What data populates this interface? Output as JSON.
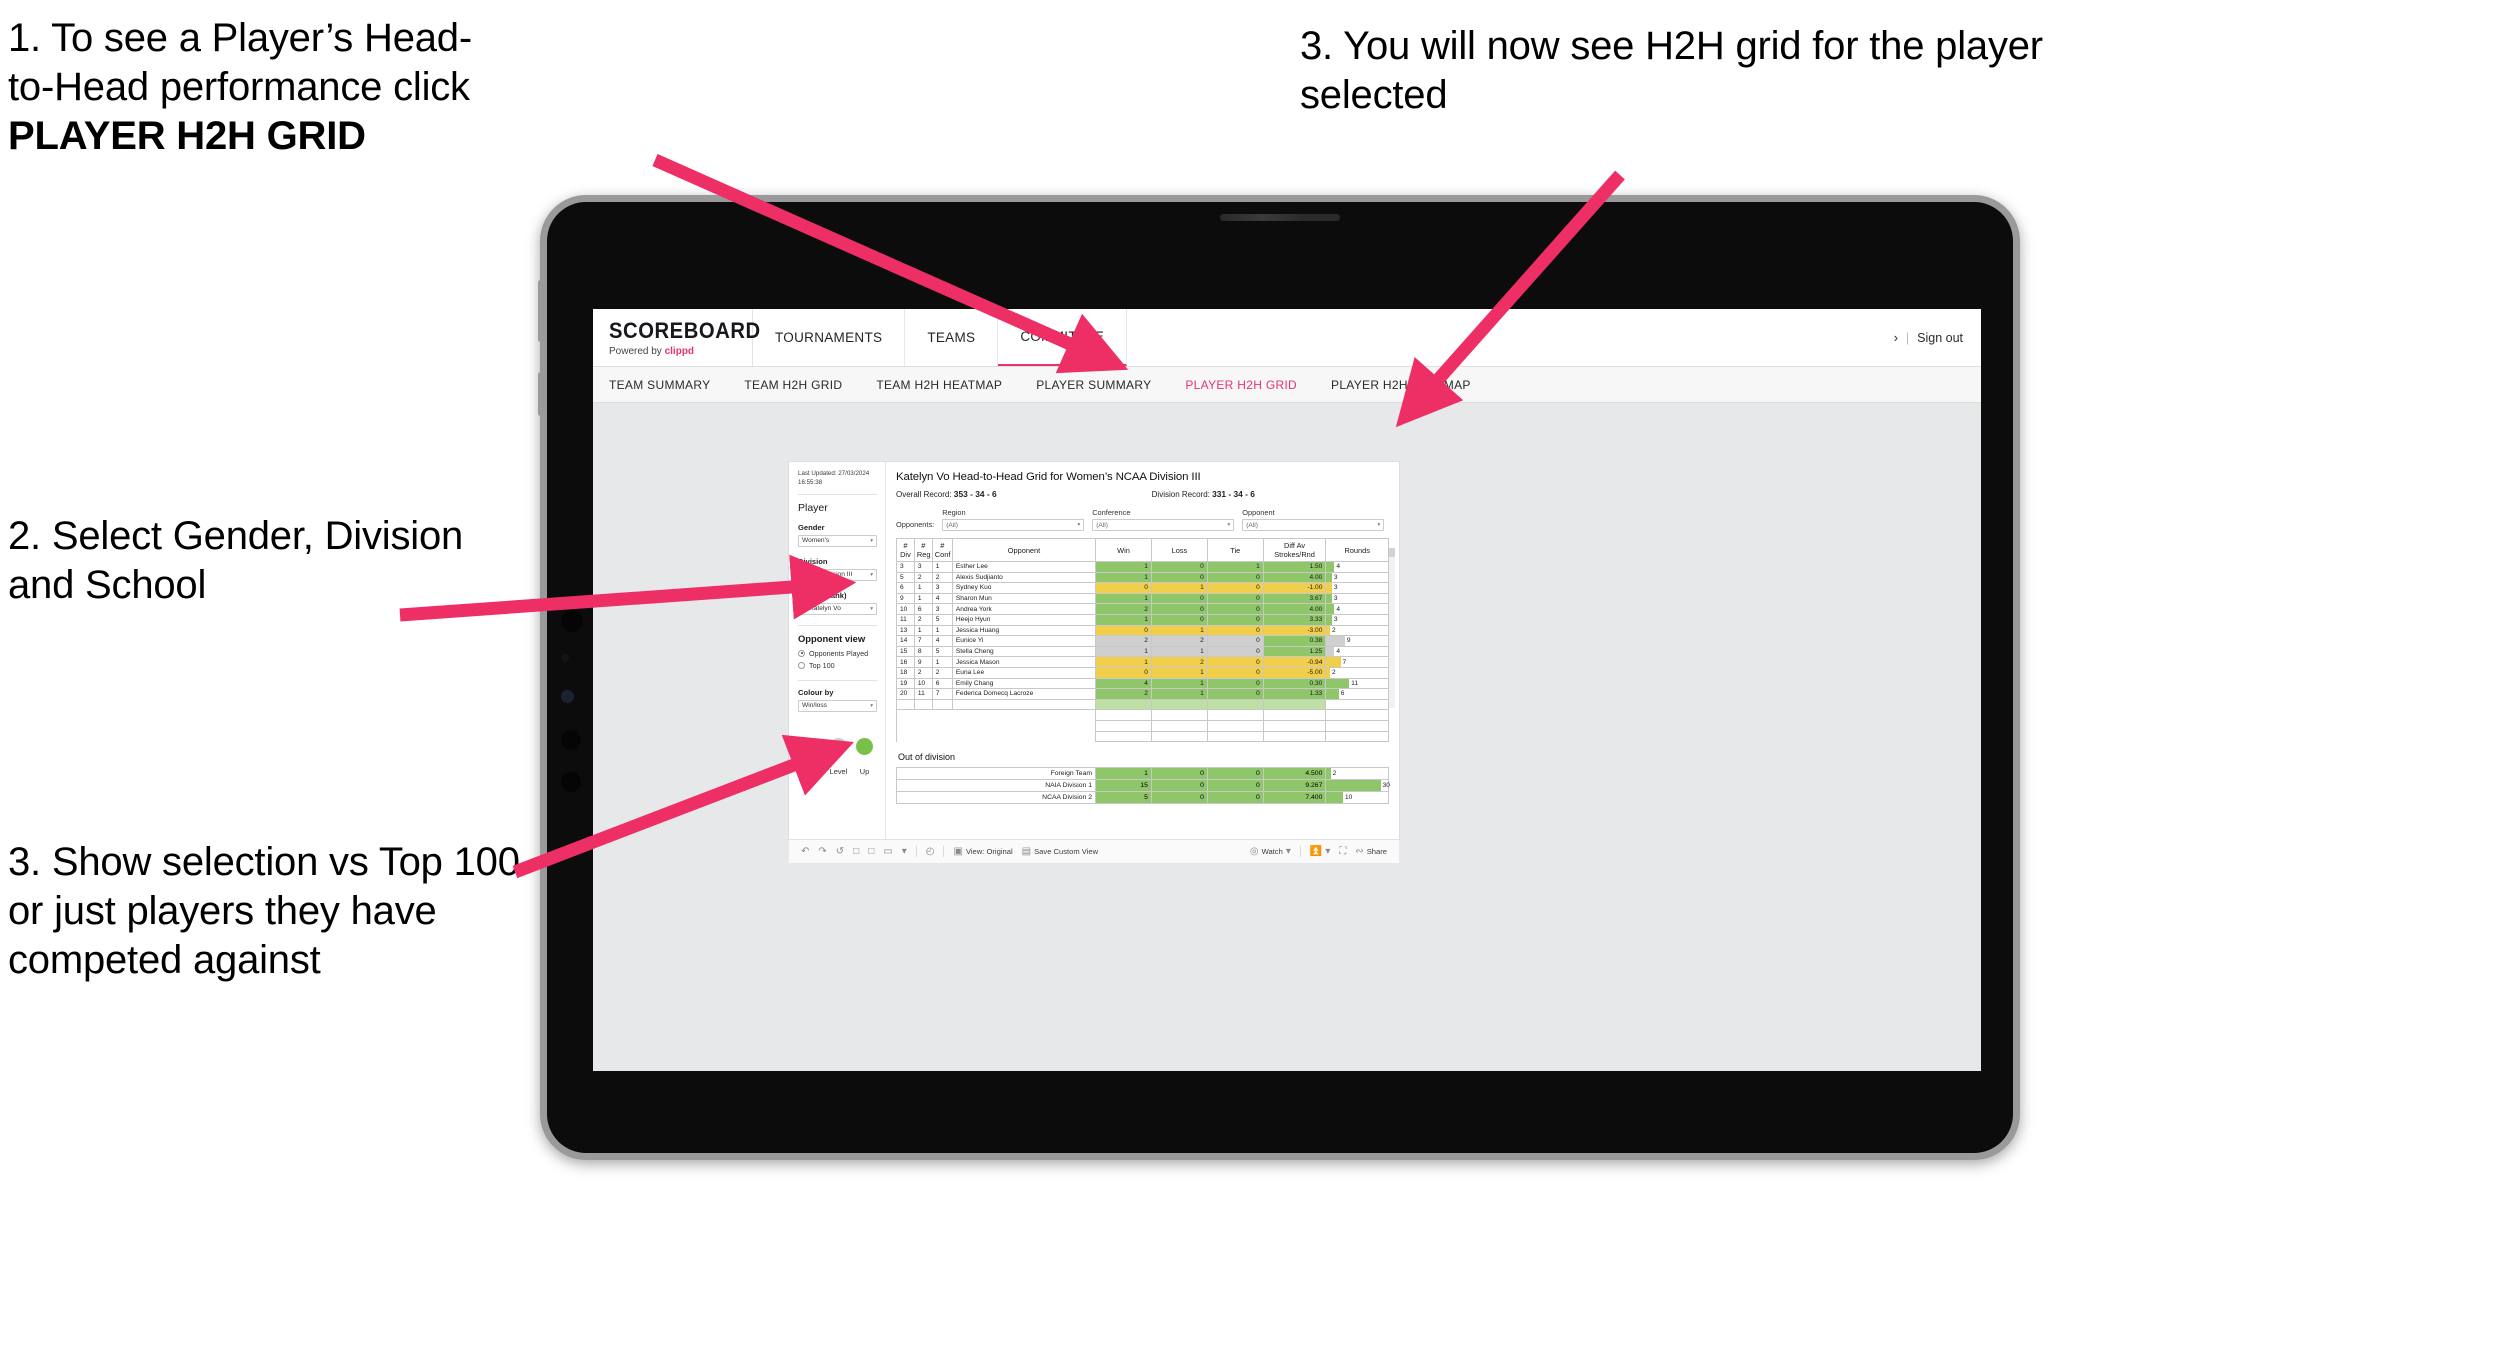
{
  "annotations": {
    "a1_line1": "1. To see a Player’s Head-",
    "a1_line2": "to-Head performance click",
    "a1_bold": "PLAYER H2H GRID",
    "a2": "2. Select Gender, Division and School",
    "a3": "3. Show selection vs Top 100 or just players they have competed against",
    "a4": "3. You will now see H2H grid for the player selected"
  },
  "brand": {
    "title": "SCOREBOARD",
    "powered_prefix": "Powered by ",
    "powered_name": "clippd"
  },
  "topnav": {
    "items": [
      "TOURNAMENTS",
      "TEAMS",
      "COMMITTEE"
    ],
    "active": "COMMITTEE",
    "chevron": "›",
    "separator": "|",
    "signout": "Sign out"
  },
  "subnav": {
    "items": [
      "TEAM SUMMARY",
      "TEAM H2H GRID",
      "TEAM H2H HEATMAP",
      "PLAYER SUMMARY",
      "PLAYER H2H GRID",
      "PLAYER H2H HEATMAP"
    ],
    "active": "PLAYER H2H GRID"
  },
  "panel": {
    "updated_line1": "Last Updated: 27/03/2024",
    "updated_line2": "16:55:38",
    "heading": "Player",
    "gender_label": "Gender",
    "gender_value": "Women's",
    "division_label": "Division",
    "division_value": "NCAA Division III",
    "player_label": "Player (Rank)",
    "player_value": "8. Katelyn Vo",
    "opponent_view_heading": "Opponent view",
    "radio_played": "Opponents Played",
    "radio_top100": "Top 100",
    "colour_by_label": "Colour by",
    "colour_by_value": "Win/loss",
    "legend": [
      {
        "label": "Down",
        "color": "#f2cf4a"
      },
      {
        "label": "Level",
        "color": "#cfcfcf"
      },
      {
        "label": "Up",
        "color": "#8fc66a"
      }
    ],
    "caret": "▾"
  },
  "viz": {
    "title": "Katelyn Vo Head-to-Head Grid for Women’s NCAA Division III",
    "overall_label": "Overall Record: ",
    "overall_value": "353 -  34 - 6",
    "division_label": "Division Record: ",
    "division_value": "331 -  34 - 6",
    "opponents_label": "Opponents:",
    "filters": [
      {
        "label": "Region",
        "value": "(All)"
      },
      {
        "label": "Conference",
        "value": "(All)"
      },
      {
        "label": "Opponent",
        "value": "(All)"
      }
    ],
    "headers": [
      "#\nDiv",
      "#\nReg",
      "#\nConf",
      "Opponent",
      "Win",
      "Loss",
      "Tie",
      "Diff Av\nStrokes/Rnd",
      "Rounds"
    ],
    "header_div_1": "#",
    "header_div_2": "Div",
    "header_reg_1": "#",
    "header_reg_2": "Reg",
    "header_conf_1": "#",
    "header_conf_2": "Conf",
    "header_opponent": "Opponent",
    "header_win": "Win",
    "header_loss": "Loss",
    "header_tie": "Tie",
    "header_diff_1": "Diff Av",
    "header_diff_2": "Strokes/Rnd",
    "header_rounds": "Rounds",
    "out_of_division_title": "Out of division"
  },
  "chart_data": {
    "type": "table",
    "title": "Katelyn Vo Head-to-Head Grid for Women’s NCAA Division III",
    "columns": [
      "# Div",
      "# Reg",
      "# Conf",
      "Opponent",
      "Win",
      "Loss",
      "Tie",
      "Diff Av Strokes/Rnd",
      "Rounds"
    ],
    "rows": [
      {
        "div": "3",
        "reg": "3",
        "conf": "1",
        "opponent": "Esther Lee",
        "win": "1",
        "loss": "0",
        "tie": "1",
        "diff": "1.50",
        "rounds": "4",
        "state": "up",
        "diff_state": "up",
        "rounds_pct": 13
      },
      {
        "div": "5",
        "reg": "2",
        "conf": "2",
        "opponent": "Alexis Sudjianto",
        "win": "1",
        "loss": "0",
        "tie": "0",
        "diff": "4.00",
        "rounds": "3",
        "state": "up",
        "diff_state": "up",
        "rounds_pct": 9
      },
      {
        "div": "6",
        "reg": "1",
        "conf": "3",
        "opponent": "Sydney Kuo",
        "win": "0",
        "loss": "1",
        "tie": "0",
        "diff": "-1.00",
        "rounds": "3",
        "state": "down",
        "diff_state": "down",
        "rounds_pct": 9
      },
      {
        "div": "9",
        "reg": "1",
        "conf": "4",
        "opponent": "Sharon Mun",
        "win": "1",
        "loss": "0",
        "tie": "0",
        "diff": "3.67",
        "rounds": "3",
        "state": "up",
        "diff_state": "up",
        "rounds_pct": 9
      },
      {
        "div": "10",
        "reg": "6",
        "conf": "3",
        "opponent": "Andrea York",
        "win": "2",
        "loss": "0",
        "tie": "0",
        "diff": "4.00",
        "rounds": "4",
        "state": "up",
        "diff_state": "up",
        "rounds_pct": 13
      },
      {
        "div": "11",
        "reg": "2",
        "conf": "5",
        "opponent": "Heejo Hyun",
        "win": "1",
        "loss": "0",
        "tie": "0",
        "diff": "3.33",
        "rounds": "3",
        "state": "up",
        "diff_state": "up",
        "rounds_pct": 9
      },
      {
        "div": "13",
        "reg": "1",
        "conf": "1",
        "opponent": "Jessica Huang",
        "win": "0",
        "loss": "1",
        "tie": "0",
        "diff": "-3.00",
        "rounds": "2",
        "state": "down",
        "diff_state": "down",
        "rounds_pct": 6
      },
      {
        "div": "14",
        "reg": "7",
        "conf": "4",
        "opponent": "Eunice Yi",
        "win": "2",
        "loss": "2",
        "tie": "0",
        "diff": "0.38",
        "rounds": "9",
        "state": "level",
        "diff_state": "up",
        "rounds_pct": 30
      },
      {
        "div": "15",
        "reg": "8",
        "conf": "5",
        "opponent": "Stella Cheng",
        "win": "1",
        "loss": "1",
        "tie": "0",
        "diff": "1.25",
        "rounds": "4",
        "state": "level",
        "diff_state": "up",
        "rounds_pct": 13
      },
      {
        "div": "16",
        "reg": "9",
        "conf": "1",
        "opponent": "Jessica Mason",
        "win": "1",
        "loss": "2",
        "tie": "0",
        "diff": "-0.94",
        "rounds": "7",
        "state": "down",
        "diff_state": "down",
        "rounds_pct": 23
      },
      {
        "div": "18",
        "reg": "2",
        "conf": "2",
        "opponent": "Euna Lee",
        "win": "0",
        "loss": "1",
        "tie": "0",
        "diff": "-5.00",
        "rounds": "2",
        "state": "down",
        "diff_state": "down",
        "rounds_pct": 6
      },
      {
        "div": "19",
        "reg": "10",
        "conf": "6",
        "opponent": "Emily Chang",
        "win": "4",
        "loss": "1",
        "tie": "0",
        "diff": "0.30",
        "rounds": "11",
        "state": "up",
        "diff_state": "up",
        "rounds_pct": 37
      },
      {
        "div": "20",
        "reg": "11",
        "conf": "7",
        "opponent": "Federica Domecq Lacroze",
        "win": "2",
        "loss": "1",
        "tie": "0",
        "diff": "1.33",
        "rounds": "6",
        "state": "up",
        "diff_state": "up",
        "rounds_pct": 20
      }
    ],
    "out_of_division": [
      {
        "name": "Foreign Team",
        "win": "1",
        "loss": "0",
        "tie": "0",
        "diff": "4.500",
        "rounds": "2",
        "state": "up",
        "rounds_pct": 7
      },
      {
        "name": "NAIA Division 1",
        "win": "15",
        "loss": "0",
        "tie": "0",
        "diff": "9.267",
        "rounds": "30",
        "state": "up",
        "rounds_pct": 88
      },
      {
        "name": "NCAA Division 2",
        "win": "5",
        "loss": "0",
        "tie": "0",
        "diff": "7.400",
        "rounds": "10",
        "state": "up",
        "rounds_pct": 27
      }
    ],
    "colors": {
      "up": "#8fc66a",
      "down": "#f2cf4a",
      "level": "#cfcfcf",
      "accent": "#e8336d"
    }
  },
  "toolbar": {
    "undo": "↶",
    "redo": "↷",
    "revert": "↺",
    "refresh": "□",
    "pause": "□",
    "rect": "▭",
    "caret": "▾",
    "clock": "◴",
    "view_label": "View: Original",
    "save_label": "Save Custom View",
    "watch_label": "Watch",
    "download_label": "",
    "fullscreen_label": "",
    "share_label": "Share"
  }
}
